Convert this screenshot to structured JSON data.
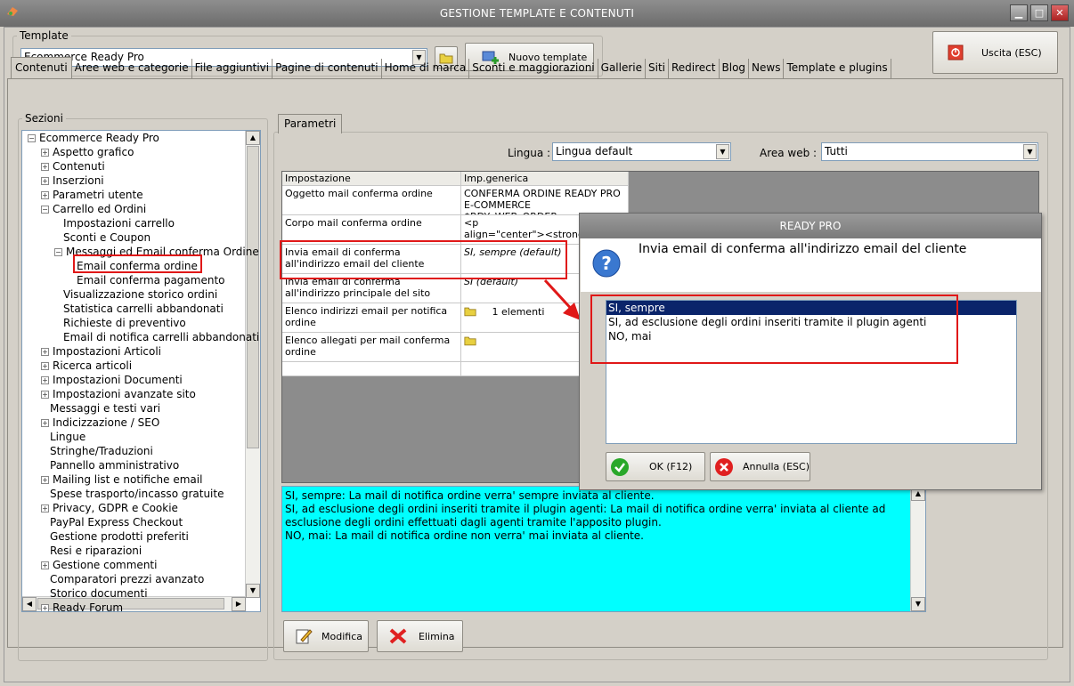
{
  "window": {
    "title": "GESTIONE TEMPLATE E CONTENUTI"
  },
  "template": {
    "group_label": "Template",
    "selected": "Ecommerce Ready Pro",
    "new_button": "Nuovo template",
    "exit_button": "Uscita (ESC)"
  },
  "tabs": [
    "Contenuti",
    "Aree web e categorie",
    "File aggiuntivi",
    "Pagine di contenuti",
    "Home di marca",
    "Sconti e maggiorazioni",
    "Gallerie",
    "Siti",
    "Redirect",
    "Blog",
    "News",
    "Template e plugins"
  ],
  "sections": {
    "label": "Sezioni",
    "tree": [
      {
        "label": "Ecommerce Ready Pro",
        "level": 0,
        "exp": "-"
      },
      {
        "label": "Aspetto grafico",
        "level": 1,
        "exp": "+"
      },
      {
        "label": "Contenuti",
        "level": 1,
        "exp": "+"
      },
      {
        "label": "Inserzioni",
        "level": 1,
        "exp": "+"
      },
      {
        "label": "Parametri utente",
        "level": 1,
        "exp": "+"
      },
      {
        "label": "Carrello ed Ordini",
        "level": 1,
        "exp": "-"
      },
      {
        "label": "Impostazioni carrello",
        "level": 2,
        "exp": ""
      },
      {
        "label": "Sconti e Coupon",
        "level": 2,
        "exp": ""
      },
      {
        "label": "Messaggi ed Email conferma Ordine",
        "level": 2,
        "exp": "-"
      },
      {
        "label": "Email conferma ordine",
        "level": 3,
        "exp": ""
      },
      {
        "label": "Email conferma pagamento",
        "level": 3,
        "exp": ""
      },
      {
        "label": "Visualizzazione storico ordini",
        "level": 2,
        "exp": ""
      },
      {
        "label": "Statistica carrelli abbandonati",
        "level": 2,
        "exp": ""
      },
      {
        "label": "Richieste di preventivo",
        "level": 2,
        "exp": ""
      },
      {
        "label": "Email di notifica carrelli abbandonati",
        "level": 2,
        "exp": ""
      },
      {
        "label": "Impostazioni Articoli",
        "level": 1,
        "exp": "+"
      },
      {
        "label": "Ricerca articoli",
        "level": 1,
        "exp": "+"
      },
      {
        "label": "Impostazioni Documenti",
        "level": 1,
        "exp": "+"
      },
      {
        "label": "Impostazioni avanzate sito",
        "level": 1,
        "exp": "+"
      },
      {
        "label": "Messaggi e testi vari",
        "level": 1,
        "exp": ""
      },
      {
        "label": "Indicizzazione / SEO",
        "level": 1,
        "exp": "+"
      },
      {
        "label": "Lingue",
        "level": 1,
        "exp": ""
      },
      {
        "label": "Stringhe/Traduzioni",
        "level": 1,
        "exp": ""
      },
      {
        "label": "Pannello amministrativo",
        "level": 1,
        "exp": ""
      },
      {
        "label": "Mailing list e notifiche email",
        "level": 1,
        "exp": "+"
      },
      {
        "label": "Spese trasporto/incasso gratuite",
        "level": 1,
        "exp": ""
      },
      {
        "label": "Privacy, GDPR e Cookie",
        "level": 1,
        "exp": "+"
      },
      {
        "label": "PayPal Express Checkout",
        "level": 1,
        "exp": ""
      },
      {
        "label": "Gestione prodotti preferiti",
        "level": 1,
        "exp": ""
      },
      {
        "label": "Resi e riparazioni",
        "level": 1,
        "exp": ""
      },
      {
        "label": "Gestione commenti",
        "level": 1,
        "exp": "+"
      },
      {
        "label": "Comparatori prezzi avanzato",
        "level": 1,
        "exp": ""
      },
      {
        "label": "Storico documenti",
        "level": 1,
        "exp": ""
      },
      {
        "label": "Ready Forum",
        "level": 1,
        "exp": "+"
      }
    ]
  },
  "params": {
    "tab": "Parametri",
    "lingua_label": "Lingua :",
    "lingua_value": "Lingua default",
    "area_label": "Area web :",
    "area_value": "Tutti",
    "headers": [
      "Impostazione",
      "Imp.generica"
    ],
    "rows": [
      {
        "name": "Oggetto mail conferma ordine",
        "value": "CONFERMA ORDINE READY PRO\nE-COMMERCE $RDY_WEB_ORDER..."
      },
      {
        "name": "Corpo mail conferma ordine",
        "value": "<p\nalign=\"center\"><strong>C"
      },
      {
        "name": "Invia email di conferma all'indirizzo email del cliente",
        "value": "SI, sempre (default)"
      },
      {
        "name": "Invia email di conferma all'indirizzo principale del sito",
        "value": "SI (default)"
      },
      {
        "name": "Elenco indirizzi email per notifica ordine",
        "value": "1 elementi"
      },
      {
        "name": "Elenco allegati per mail conferma ordine",
        "value": ""
      }
    ],
    "description": "SI, sempre: La mail di notifica ordine verra' sempre inviata al cliente.\nSI, ad esclusione degli ordini inseriti tramite il plugin agenti: La mail di notifica ordine verra' inviata al cliente ad esclusione degli ordini effettuati dagli agenti tramite l'apposito plugin.\nNO, mai: La mail di notifica ordine non verra' mai inviata al cliente.",
    "modify_button": "Modifica",
    "delete_button": "Elimina"
  },
  "dialog": {
    "title": "READY PRO",
    "question": "Invia email di conferma all'indirizzo email del cliente",
    "options": [
      "SI, sempre",
      "SI, ad esclusione degli ordini inseriti tramite il plugin agenti",
      "NO, mai"
    ],
    "ok_button": "OK (F12)",
    "cancel_button": "Annulla (ESC)"
  }
}
